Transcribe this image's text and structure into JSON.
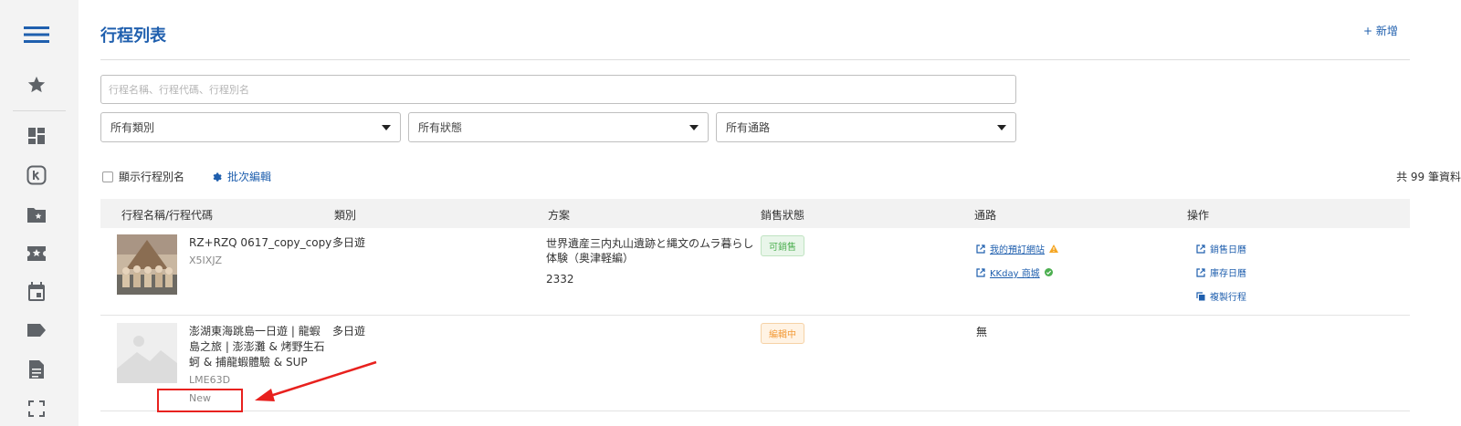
{
  "sidebar": {
    "icons": [
      "menu-icon",
      "star-icon",
      "dashboard-icon",
      "kkday-k-icon",
      "starred-folder-icon",
      "starred-label-icon",
      "calendar-icon",
      "tag-icon",
      "document-icon",
      "fullscreen-icon"
    ]
  },
  "header": {
    "title": "行程列表",
    "add_label": "+ 新增"
  },
  "filters": {
    "search_placeholder": "行程名稱、行程代碼、行程別名",
    "category": "所有類別",
    "status": "所有狀態",
    "channel": "所有通路"
  },
  "toolbar": {
    "show_alias_label": "顯示行程別名",
    "batch_edit_label": "批次編輯",
    "total_label": "共 99 筆資料"
  },
  "table": {
    "columns": [
      "行程名稱/行程代碼",
      "類別",
      "方案",
      "銷售狀態",
      "通路",
      "操作"
    ],
    "rows": [
      {
        "name": "RZ+RZQ 0617_copy_copy",
        "code": "X5IXJZ",
        "category": "多日遊",
        "plan_line1": "世界遺産三内丸山遺跡と縄文のムラ暮らし",
        "plan_line2": "体験（奥津軽編）",
        "plan_id": "2332",
        "status": "可銷售",
        "status_color": "#4caf50",
        "channels": [
          {
            "label": "我的預訂網站",
            "status_icon": "warning-icon",
            "status_color": "#f5a623"
          },
          {
            "label": "KKday 商城",
            "status_icon": "check-circle-icon",
            "status_color": "#4caf50"
          }
        ],
        "actions": [
          {
            "label": "銷售日曆",
            "icon": "external-link-icon"
          },
          {
            "label": "庫存日曆",
            "icon": "external-link-icon"
          },
          {
            "label": "複製行程",
            "icon": "copy-icon"
          }
        ]
      },
      {
        "name_lines": [
          "澎湖東海跳島一日遊 | 龍蝦",
          "島之旅 | 澎澎灘 & 烤野生石",
          "蚵 & 捕龍蝦體驗 & SUP"
        ],
        "code": "LME63D",
        "new_tag": "New",
        "category": "多日遊",
        "status": "編輯中",
        "status_color": "#f39c3a",
        "channel": "無"
      }
    ]
  },
  "colors": {
    "accent": "#1f5fae",
    "annotation": "#e8211e"
  }
}
